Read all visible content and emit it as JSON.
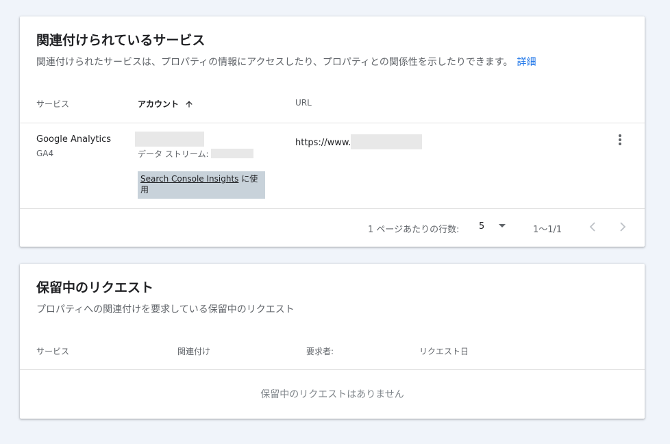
{
  "linked_services": {
    "title": "関連付けられているサービス",
    "subtitle": "関連付けられたサービスは、プロパティの情報にアクセスしたり、プロパティとの関係性を示したりできます。",
    "detail_link": "詳細",
    "columns": {
      "service": "サービス",
      "account": "アカウント",
      "url": "URL"
    },
    "row": {
      "service_name": "Google Analytics",
      "service_sub": "GA4",
      "data_stream_label": "データ ストリーム:",
      "url_prefix": "https://www.",
      "chip_link": "Search Console Insights",
      "chip_suffix": " に使用"
    },
    "pagination": {
      "rows_per_page_label": "1 ページあたりの行数:",
      "rows_per_page_value": "5",
      "range": "1〜1/1"
    }
  },
  "pending_requests": {
    "title": "保留中のリクエスト",
    "subtitle": "プロパティへの関連付けを要求している保留中のリクエスト",
    "columns": {
      "service": "サービス",
      "association": "関連付け",
      "requester": "要求者:",
      "request_date": "リクエスト日"
    },
    "empty_message": "保留中のリクエストはありません"
  },
  "icons": {
    "sort": "arrow-up-icon",
    "menu": "more-vert-icon",
    "dropdown": "caret-down-icon",
    "prev": "chevron-left-icon",
    "next": "chevron-right-icon"
  },
  "colors": {
    "background": "#f0f4fa",
    "link": "#1a73e8",
    "chip": "#c8d2da"
  }
}
